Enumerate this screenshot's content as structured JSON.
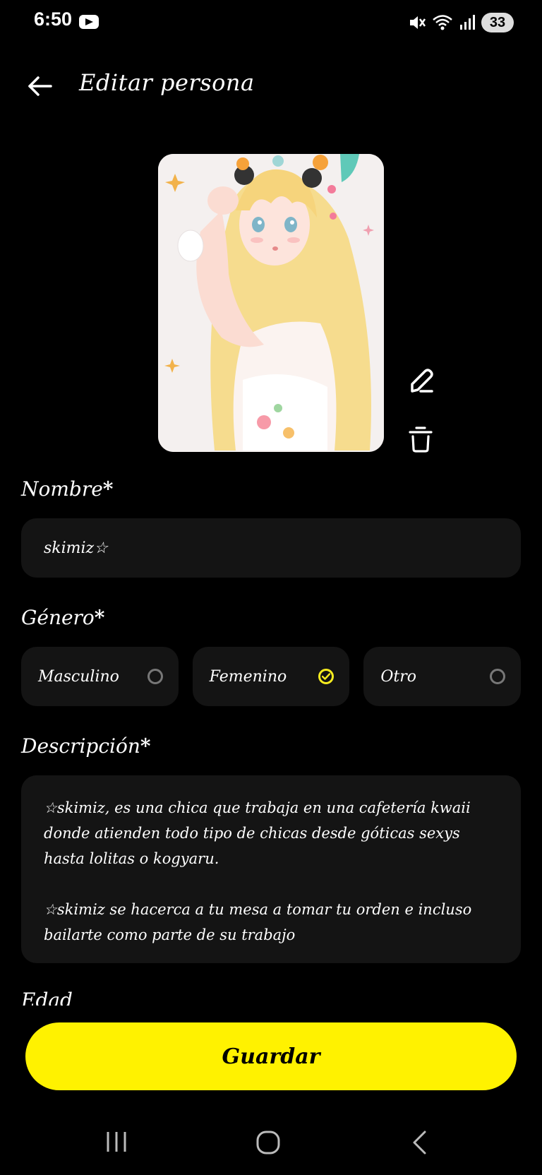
{
  "status_bar": {
    "time": "6:50",
    "battery": "33",
    "icons": [
      "youtube-icon",
      "mute-icon",
      "wifi-icon",
      "signal-icon",
      "battery-icon"
    ]
  },
  "header": {
    "title": "Editar persona"
  },
  "form": {
    "name_label": "Nombre",
    "required_mark": "*",
    "name_value": "skimiz☆",
    "gender_label": "Género",
    "gender_options": [
      {
        "label": "Masculino",
        "selected": false
      },
      {
        "label": "Femenino",
        "selected": true
      },
      {
        "label": "Otro",
        "selected": false
      }
    ],
    "description_label": "Descripción",
    "description_p1": "☆skimiz, es una chica que trabaja en una cafetería  kwaii donde atienden todo tipo de chicas desde góticas sexys hasta lolitas  o kogyaru.",
    "description_p2": "☆skimiz se hacerca  a tu mesa a tomar tu orden e incluso bailarte como parte de su trabajo",
    "age_label": "Edad"
  },
  "save_label": "Guardar",
  "colors": {
    "accent": "#fff200",
    "field_bg": "#141414",
    "background": "#000000"
  }
}
